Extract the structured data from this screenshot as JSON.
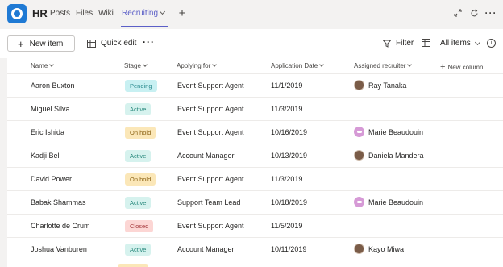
{
  "header": {
    "team_name": "HR",
    "tabs": [
      {
        "label": "Posts"
      },
      {
        "label": "Files"
      },
      {
        "label": "Wiki"
      },
      {
        "label": "Recruiting"
      }
    ],
    "accent_color": "#5b5fc7",
    "icons": [
      "expand-icon",
      "refresh-icon",
      "more-icon"
    ]
  },
  "toolbar": {
    "new_item_label": "New item",
    "quick_edit_label": "Quick edit",
    "more_label": "···",
    "filter_label": "Filter",
    "view_label": "All items"
  },
  "list": {
    "columns": [
      "Name",
      "Stage",
      "Applying for",
      "Application Date",
      "Assigned recruiter",
      "New column"
    ],
    "rows": [
      {
        "name": "Aaron Buxton",
        "stage": "Pending",
        "applying_for": "Event Support Agent",
        "date": "11/1/2019",
        "recruiter": "Ray Tanaka",
        "avatar": "photo"
      },
      {
        "name": "Miguel Silva",
        "stage": "Active",
        "applying_for": "Event Support Agent",
        "date": "11/3/2019",
        "recruiter": "",
        "avatar": ""
      },
      {
        "name": "Eric Ishida",
        "stage": "On hold",
        "applying_for": "Event Support Agent",
        "date": "10/16/2019",
        "recruiter": "Marie Beaudouin",
        "avatar": "initials"
      },
      {
        "name": "Kadji Bell",
        "stage": "Active",
        "applying_for": "Account Manager",
        "date": "10/13/2019",
        "recruiter": "Daniela Mandera",
        "avatar": "photo"
      },
      {
        "name": "David Power",
        "stage": "On hold",
        "applying_for": "Event Support Agent",
        "date": "11/3/2019",
        "recruiter": "",
        "avatar": ""
      },
      {
        "name": "Babak Shammas",
        "stage": "Active",
        "applying_for": "Support Team Lead",
        "date": "10/18/2019",
        "recruiter": "Marie Beaudouin",
        "avatar": "initials"
      },
      {
        "name": "Charlotte de Crum",
        "stage": "Closed",
        "applying_for": "Event Support Agent",
        "date": "11/5/2019",
        "recruiter": "",
        "avatar": ""
      },
      {
        "name": "Joshua Vanburen",
        "stage": "Active",
        "applying_for": "Account Manager",
        "date": "10/11/2019",
        "recruiter": "Kayo Miwa",
        "avatar": "photo"
      }
    ]
  }
}
